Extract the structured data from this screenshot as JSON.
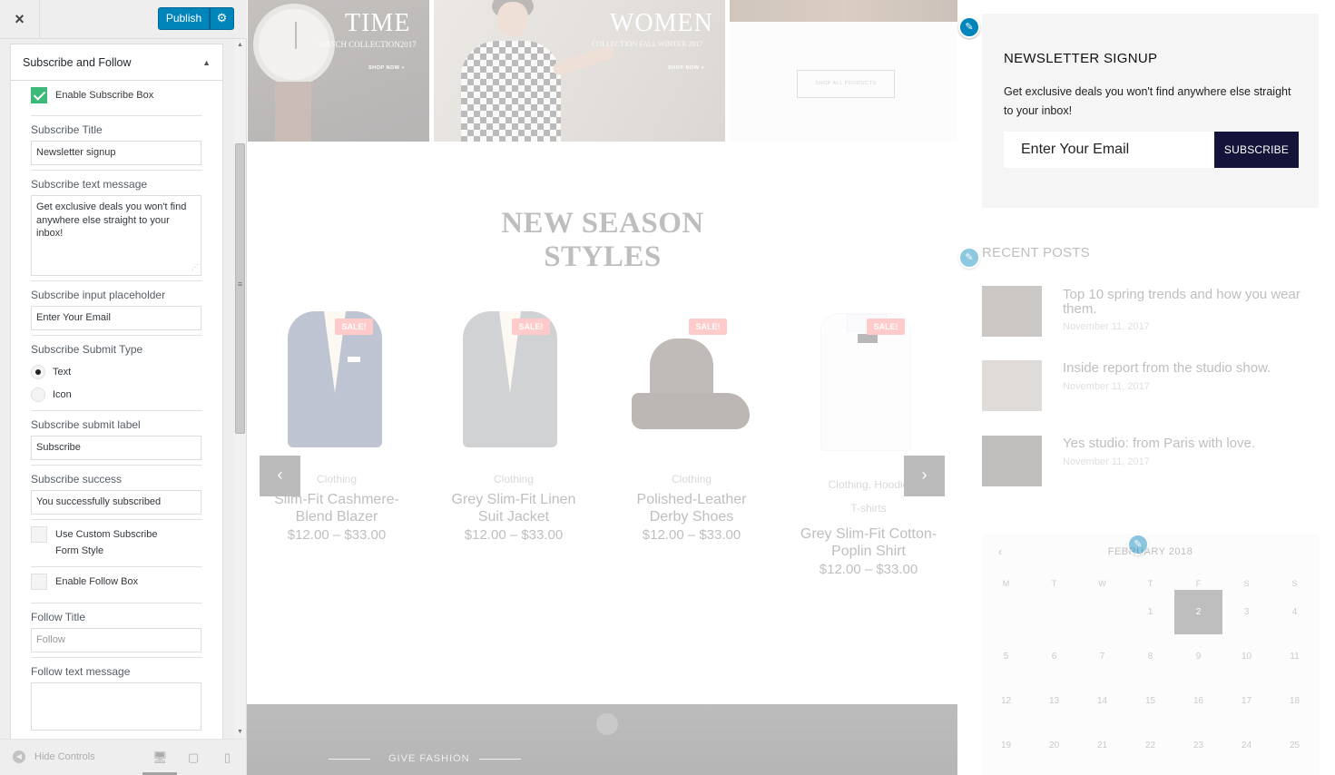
{
  "customizer": {
    "close_icon": "×",
    "publish_label": "Publish",
    "gear_icon": "⚙",
    "section_title": "Subscribe and Follow",
    "enable_subscribe_label": "Enable Subscribe Box",
    "enable_subscribe_checked": true,
    "subscribe_title_label": "Subscribe Title",
    "subscribe_title_value": "Newsletter signup",
    "subscribe_text_label": "Subscribe text message",
    "subscribe_text_value": "Get exclusive deals you won't find anywhere else straight to your inbox!",
    "placeholder_label": "Subscribe input placeholder",
    "placeholder_value": "Enter Your Email",
    "submit_type_label": "Subscribe Submit Type",
    "submit_type_options": [
      "Text",
      "Icon"
    ],
    "submit_type_selected": "Text",
    "submit_label_label": "Subscribe submit label",
    "submit_label_value": "Subscribe",
    "success_label": "Subscribe success",
    "success_value": "You successfully subscribed",
    "custom_form_label": "Use Custom Subscribe Form Style",
    "enable_follow_label": "Enable Follow Box",
    "follow_title_label": "Follow Title",
    "follow_title_placeholder": "Follow",
    "follow_text_label": "Follow text message",
    "hide_controls_label": "Hide Controls"
  },
  "preview": {
    "banners": [
      {
        "title": "TIME",
        "subtitle": "WATCH COLLECTION2017",
        "link": "SHOP NOW »"
      },
      {
        "title": "WOMEN",
        "subtitle": "COLLECTION FALL WINTER 2017",
        "link": "SHOP NOW »"
      },
      {
        "link": "SHOP ALL PRODUCTS"
      }
    ],
    "section_heading": "NEW SEASON STYLES",
    "sale_badge": "SALE!",
    "products": [
      {
        "category": "Clothing",
        "name": "Slim-Fit Cashmere-Blend Blazer",
        "price": "$12.00 – $33.00"
      },
      {
        "category": "Clothing",
        "name": "Grey Slim-Fit Linen Suit Jacket",
        "price": "$12.00 – $33.00"
      },
      {
        "category": "Clothing",
        "name": "Polished-Leather Derby Shoes",
        "price": "$12.00 – $33.00"
      },
      {
        "category": "Clothing, Hoodie",
        "category2": "T-shirts",
        "name": "Grey Slim-Fit Cotton-Poplin Shirt",
        "price": "$12.00 – $33.00"
      }
    ],
    "bottom_banner_label": "GIVE FASHION",
    "newsletter": {
      "title": "NEWSLETTER SIGNUP",
      "message": "Get exclusive deals you won't find anywhere else straight to your inbox!",
      "input_text": "Enter Your Email",
      "button": "SUBSCRIBE"
    },
    "recent_posts": {
      "title": "RECENT POSTS",
      "posts": [
        {
          "title": "Top 10 spring trends and how you wear them.",
          "date": "November 11, 2017"
        },
        {
          "title": "Inside report from the studio show.",
          "date": "November 11, 2017"
        },
        {
          "title": "Yes studio: from Paris with love.",
          "date": "November 11, 2017"
        }
      ]
    },
    "calendar": {
      "month": "FEBRUARY 2018",
      "prev": "‹",
      "dow": [
        "M",
        "T",
        "W",
        "T",
        "F",
        "S",
        "S"
      ],
      "weeks": [
        [
          "",
          "",
          "",
          "1",
          "2",
          "3",
          "4"
        ],
        [
          "5",
          "6",
          "7",
          "8",
          "9",
          "10",
          "11"
        ],
        [
          "12",
          "13",
          "14",
          "15",
          "16",
          "17",
          "18"
        ],
        [
          "19",
          "20",
          "21",
          "22",
          "23",
          "24",
          "25"
        ]
      ],
      "today": "2"
    }
  },
  "colors": {
    "primary": "#0085ba",
    "checked": "#3cb878",
    "subscribe_button": "#14143a",
    "sale": "#ff5a5a"
  }
}
